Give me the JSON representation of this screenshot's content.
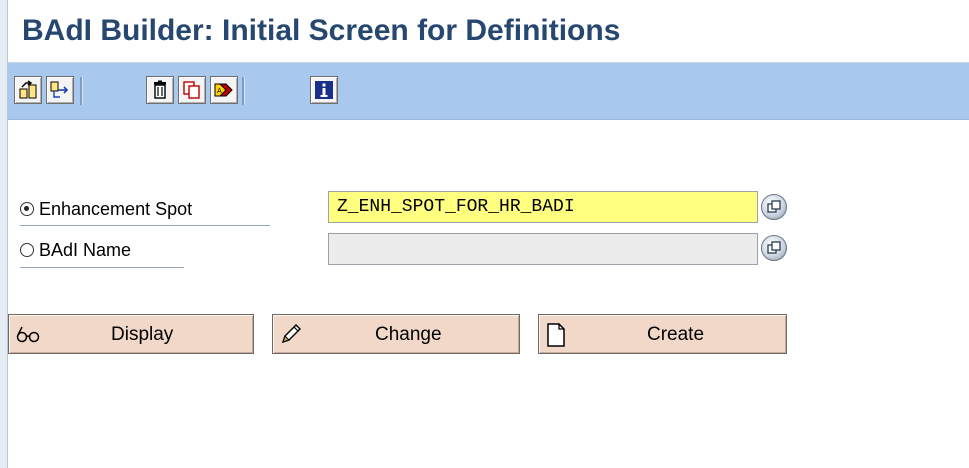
{
  "window": {
    "title": "BAdI Builder: Initial Screen for Definitions"
  },
  "toolbar": {
    "buttons": [
      {
        "icon": "other-object-icon"
      },
      {
        "icon": "where-used-icon"
      },
      {
        "icon": "delete-icon"
      },
      {
        "icon": "copy-icon"
      },
      {
        "icon": "rename-icon"
      },
      {
        "icon": "information-icon"
      }
    ]
  },
  "form": {
    "enhancement_spot": {
      "label": "Enhancement Spot",
      "value": "Z_ENH_SPOT_FOR_HR_BADI",
      "selected": true
    },
    "badi_name": {
      "label": "BAdI Name",
      "value": "",
      "selected": false
    }
  },
  "actions": {
    "display": {
      "label": "Display",
      "icon": "glasses-icon"
    },
    "change": {
      "label": "Change",
      "icon": "pencil-icon"
    },
    "create": {
      "label": "Create",
      "icon": "blank-page-icon"
    }
  },
  "colors": {
    "title": "#26476f",
    "toolbar": "#a9c8ee",
    "input_active": "#ffff80",
    "input_inactive": "#ececec",
    "action_button": "#f1d8c8"
  }
}
